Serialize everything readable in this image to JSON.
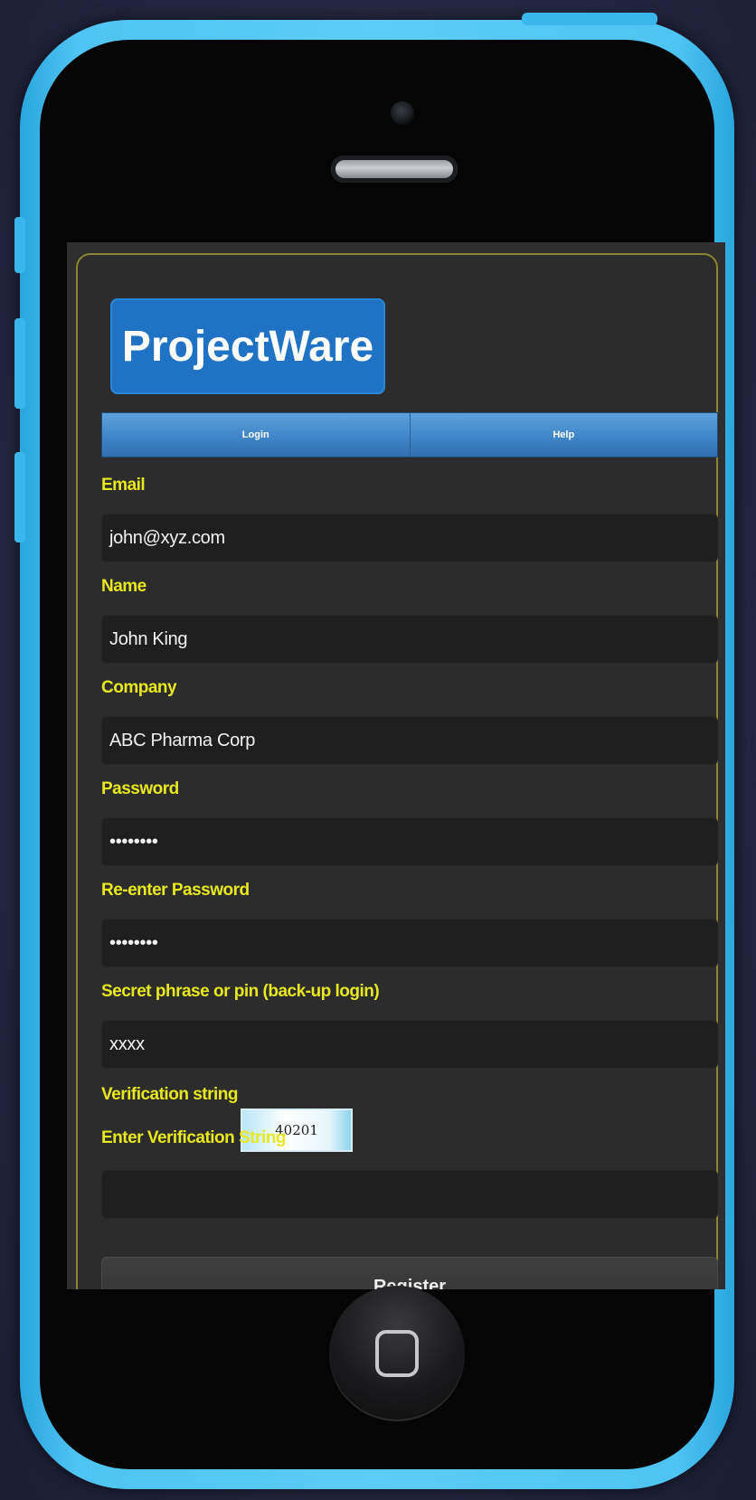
{
  "app": {
    "logo_text": "ProjectWare"
  },
  "nav": {
    "items": [
      "Login",
      "Help"
    ]
  },
  "form": {
    "fields": [
      {
        "label": "Email",
        "value": "john@xyz.com"
      },
      {
        "label": "Name",
        "value": "John King"
      },
      {
        "label": "Company",
        "value": "ABC Pharma Corp"
      },
      {
        "label": "Password",
        "value": "••••••••"
      },
      {
        "label": "Re-enter Password",
        "value": "••••••••"
      },
      {
        "label": "Secret phrase or pin (back-up login)",
        "value": "xxxx"
      }
    ],
    "verification_label": "Verification string",
    "verification_code": "40201",
    "enter_verification_label": "Enter Verification String",
    "enter_verification_value": "",
    "register_label": "Register"
  },
  "colors": {
    "label": "#e8e820",
    "logo_bg": "#1f72c4",
    "device_frame": "#4ec4f2"
  },
  "icons": {
    "home": "home-button-icon",
    "camera": "front-camera-icon",
    "speaker": "earpiece-speaker-icon"
  }
}
